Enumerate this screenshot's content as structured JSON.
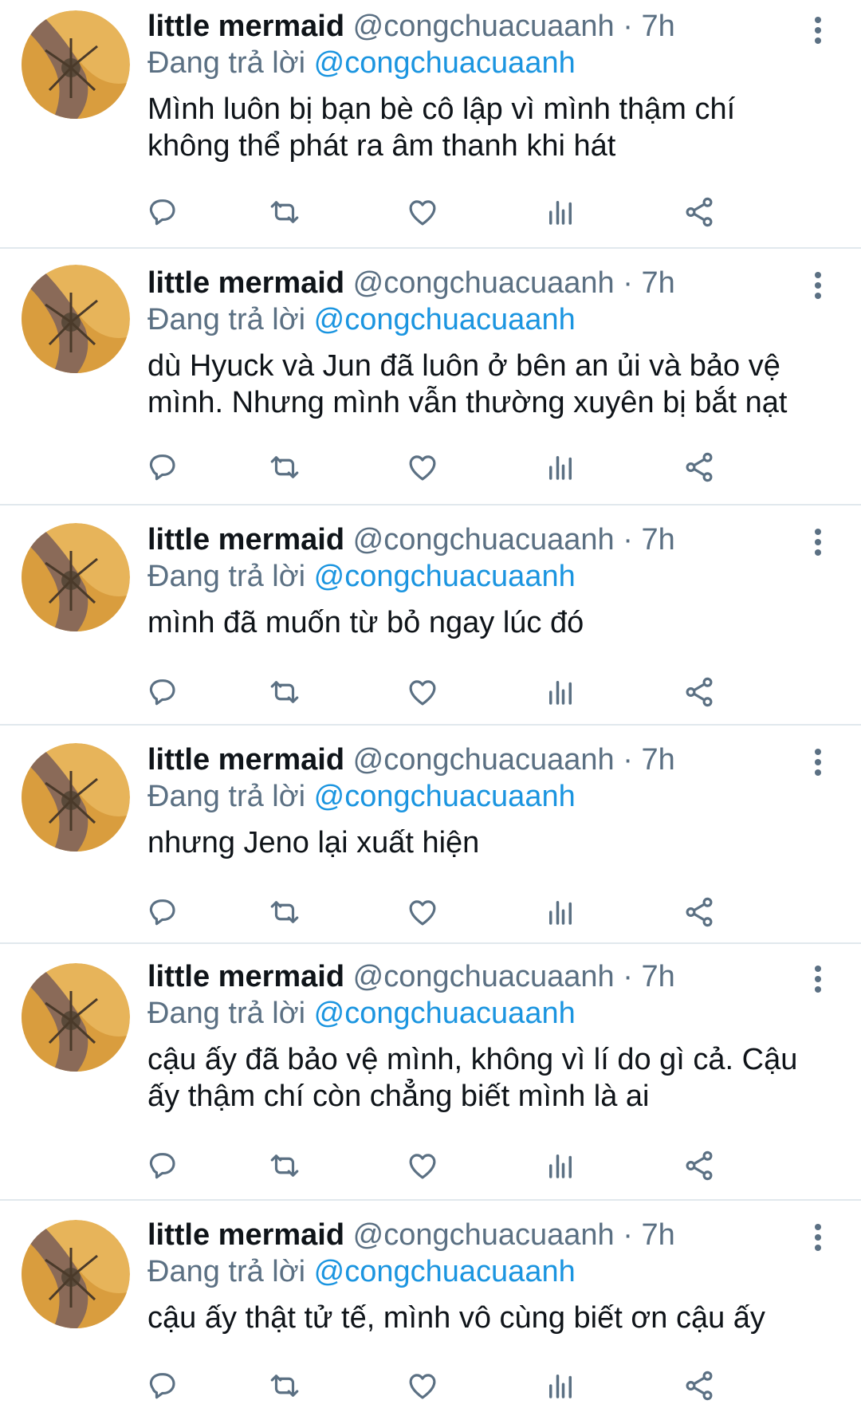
{
  "colors": {
    "text": "#0f1419",
    "secondary": "#5b7083",
    "mention": "#1b95e0",
    "divider": "#e1e8ed",
    "avatar_bg": "#e7b45a"
  },
  "icons": {
    "more": "more-vertical-icon",
    "reply": "reply-icon",
    "retweet": "retweet-icon",
    "like": "heart-icon",
    "analytics": "analytics-icon",
    "share": "share-icon"
  },
  "tweets": [
    {
      "display_name": "little mermaid",
      "handle": "@congchuacuaanh",
      "separator": "·",
      "time": "7h",
      "reply_prefix": "Đang trả lời",
      "reply_to": "@congchuacuaanh",
      "lines": [
        "Mình luôn bị bạn bè cô lập vì mình thậm chí",
        "không thể phát ra âm thanh khi hát"
      ]
    },
    {
      "display_name": "little mermaid",
      "handle": "@congchuacuaanh",
      "separator": "·",
      "time": "7h",
      "reply_prefix": "Đang trả lời",
      "reply_to": "@congchuacuaanh",
      "lines": [
        "dù Hyuck và Jun đã luôn ở bên an ủi và bảo vệ",
        "mình. Nhưng mình vẫn thường xuyên bị bắt nạt"
      ]
    },
    {
      "display_name": "little mermaid",
      "handle": "@congchuacuaanh",
      "separator": "·",
      "time": "7h",
      "reply_prefix": "Đang trả lời",
      "reply_to": "@congchuacuaanh",
      "lines": [
        "mình đã muốn từ bỏ ngay lúc đó"
      ]
    },
    {
      "display_name": "little mermaid",
      "handle": "@congchuacuaanh",
      "separator": "·",
      "time": "7h",
      "reply_prefix": "Đang trả lời",
      "reply_to": "@congchuacuaanh",
      "lines": [
        "nhưng Jeno lại xuất hiện"
      ]
    },
    {
      "display_name": "little mermaid",
      "handle": "@congchuacuaanh",
      "separator": "·",
      "time": "7h",
      "reply_prefix": "Đang trả lời",
      "reply_to": "@congchuacuaanh",
      "lines": [
        "cậu ấy đã bảo vệ mình, không vì lí do gì cả. Cậu",
        "ấy thậm chí còn chẳng biết mình là ai"
      ]
    },
    {
      "display_name": "little mermaid",
      "handle": "@congchuacuaanh",
      "separator": "·",
      "time": "7h",
      "reply_prefix": "Đang trả lời",
      "reply_to": "@congchuacuaanh",
      "lines": [
        "cậu ấy thật tử tế, mình vô cùng biết ơn cậu ấy"
      ]
    }
  ]
}
